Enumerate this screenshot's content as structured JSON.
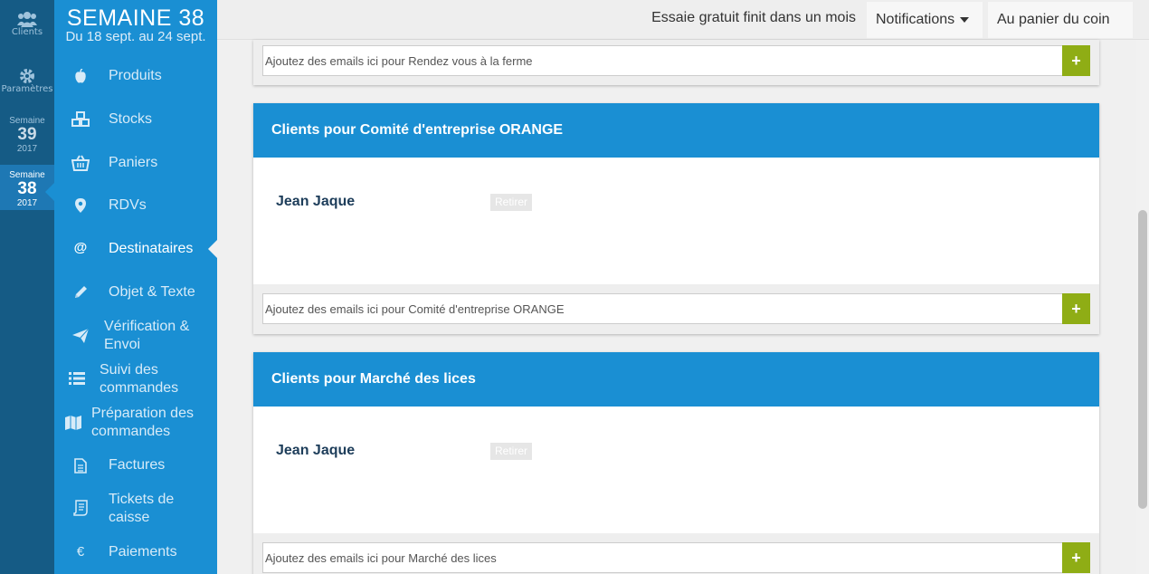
{
  "rail": {
    "clients_label": "Clients",
    "settings_label": "Paramètres",
    "weeks": [
      {
        "label": "Semaine",
        "number": "39",
        "year": "2017"
      },
      {
        "label": "Semaine",
        "number": "38",
        "year": "2017",
        "active": true
      }
    ]
  },
  "sidebar": {
    "week_title": "SEMAINE 38",
    "week_range": "Du 18 sept. au 24 sept.",
    "items": [
      {
        "label": "Produits",
        "icon": "apple-icon"
      },
      {
        "label": "Stocks",
        "icon": "cubes-icon"
      },
      {
        "label": "Paniers",
        "icon": "basket-icon"
      },
      {
        "label": "RDVs",
        "icon": "map-marker-icon"
      },
      {
        "label": "Destinataires",
        "icon": "at-icon",
        "active": true
      },
      {
        "label": "Objet & Texte",
        "icon": "pencil-icon"
      },
      {
        "label": "Vérification & Envoi",
        "icon": "paper-plane-icon"
      },
      {
        "label": "Suivi des commandes",
        "icon": "list-icon"
      },
      {
        "label": "Préparation des commandes",
        "icon": "map-icon"
      },
      {
        "label": "Factures",
        "icon": "file-text-icon"
      },
      {
        "label": "Tickets de caisse",
        "icon": "receipt-icon"
      },
      {
        "label": "Paiements",
        "icon": "euro-icon"
      }
    ]
  },
  "topbar": {
    "trial_text": "Essaie gratuit finit dans un mois",
    "notifications_label": "Notifications",
    "shop_label": "Au panier du coin"
  },
  "cards": [
    {
      "placeholder": "Ajoutez des emails ici pour Rendez vous à la ferme",
      "add_label": "+"
    },
    {
      "title": "Clients pour Comité d'entreprise ORANGE",
      "client": "Jean Jaque",
      "remove_label": "Retirer",
      "placeholder": "Ajoutez des emails ici pour Comité d'entreprise ORANGE",
      "add_label": "+"
    },
    {
      "title": "Clients pour Marché des lices",
      "client": "Jean Jaque",
      "remove_label": "Retirer",
      "placeholder": "Ajoutez des emails ici pour Marché des lices",
      "add_label": "+"
    }
  ],
  "colors": {
    "primary": "#1a8fd3",
    "rail": "#155b85",
    "accent_green": "#8fad15"
  }
}
